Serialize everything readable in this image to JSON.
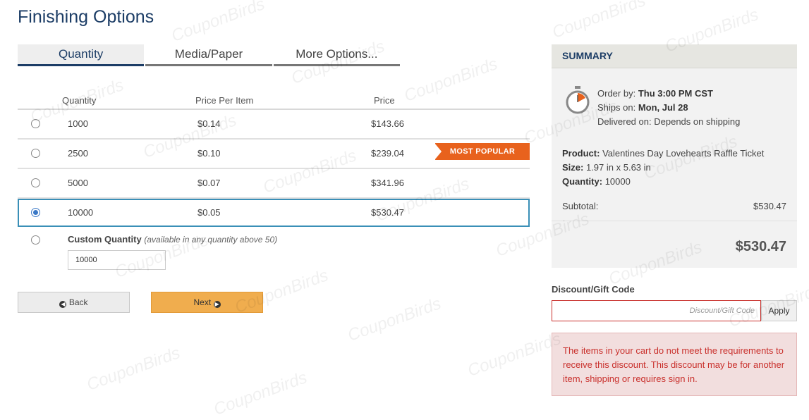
{
  "page_title": "Finishing Options",
  "tabs": [
    {
      "label": "Quantity",
      "active": true
    },
    {
      "label": "Media/Paper",
      "active": false
    },
    {
      "label": "More Options...",
      "active": false
    }
  ],
  "table": {
    "headers": {
      "quantity": "Quantity",
      "price_per_item": "Price Per Item",
      "price": "Price"
    },
    "rows": [
      {
        "quantity": "1000",
        "per_item": "$0.14",
        "price": "$143.66",
        "selected": false
      },
      {
        "quantity": "2500",
        "per_item": "$0.10",
        "price": "$239.04",
        "selected": false,
        "badge": "MOST POPULAR"
      },
      {
        "quantity": "5000",
        "per_item": "$0.07",
        "price": "$341.96",
        "selected": false
      },
      {
        "quantity": "10000",
        "per_item": "$0.05",
        "price": "$530.47",
        "selected": true
      }
    ]
  },
  "custom": {
    "label": "Custom Quantity",
    "note": "(available in any quantity above 50)",
    "value": "10000"
  },
  "buttons": {
    "back": "Back",
    "next": "Next"
  },
  "summary": {
    "heading": "SUMMARY",
    "order_by_label": "Order by:",
    "order_by_value": "Thu 3:00 PM CST",
    "ships_on_label": "Ships on:",
    "ships_on_value": "Mon, Jul 28",
    "delivered_label": "Delivered on:",
    "delivered_value": "Depends on shipping",
    "product_label": "Product:",
    "product_value": "Valentines Day Lovehearts Raffle Ticket",
    "size_label": "Size:",
    "size_value": "1.97 in x 5.63 in",
    "quantity_label": "Quantity:",
    "quantity_value": "10000",
    "subtotal_label": "Subtotal:",
    "subtotal_value": "$530.47",
    "total": "$530.47"
  },
  "discount": {
    "label": "Discount/Gift Code",
    "placeholder": "Discount/Gift Code",
    "apply": "Apply",
    "error": "The items in your cart do not meet the requirements to receive this discount. This discount may be for another item, shipping or requires sign in."
  },
  "watermark": "CouponBirds",
  "colors": {
    "accent": "#1c3d66",
    "badge": "#e8621d",
    "next_button": "#f0ad4e",
    "error": "#c9302c",
    "clock_hand": "#e8621d"
  }
}
